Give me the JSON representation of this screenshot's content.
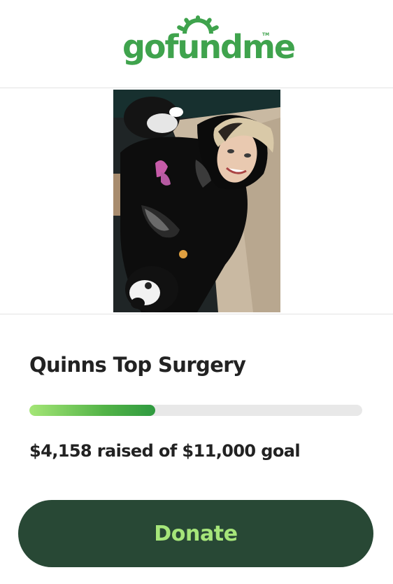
{
  "brand": {
    "logo_text": "gofundme",
    "tm": "TM",
    "logo_color": "#3fa34d"
  },
  "campaign": {
    "photo_alt": "Campaign photo",
    "title": "Quinns Top Surgery",
    "raised_text": "$4,158 raised of $11,000 goal",
    "raised_amount": 4158,
    "goal_amount": 11000,
    "progress_fraction": 0.378
  },
  "cta": {
    "donate_label": "Donate",
    "button_color": "#284835",
    "label_color": "#a6e67a"
  },
  "progress_colors": {
    "track": "#e8e8e8",
    "fill_start": "#a4e676",
    "fill_end": "#2f9a40"
  }
}
